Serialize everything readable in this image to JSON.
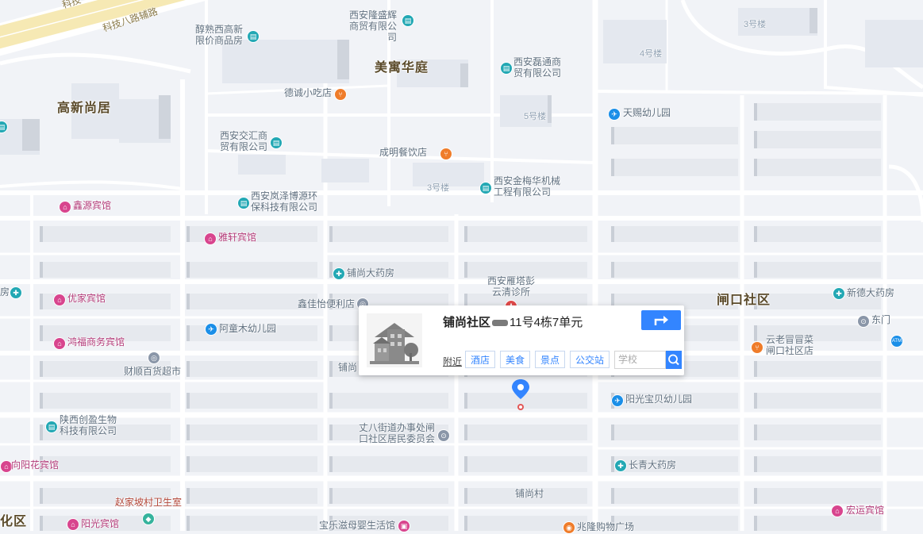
{
  "map": {
    "district_labels": [
      "美寓华庭",
      "高新尚居",
      "闸口社区",
      "化区"
    ],
    "road_labels": [
      "科技八路辅路",
      "科技"
    ],
    "building_labels": [
      "3号楼",
      "4号楼",
      "5号楼",
      "3号楼"
    ],
    "pois": [
      {
        "name": "西安隆盛辉商贸有限公司",
        "cat": "company"
      },
      {
        "name": "醇熟西高新限价商品房",
        "cat": "company"
      },
      {
        "name": "西安磊通商贸有限公司",
        "cat": "company"
      },
      {
        "name": "德诚小吃店",
        "cat": "food"
      },
      {
        "name": "天赐幼儿园",
        "cat": "school"
      },
      {
        "name": "西安交汇商贸有限公司",
        "cat": "company"
      },
      {
        "name": "成明餐饮店",
        "cat": "food"
      },
      {
        "name": "西安金梅华机械工程有限公司",
        "cat": "company"
      },
      {
        "name": "西安岚泽博源环保科技有限公司",
        "cat": "company"
      },
      {
        "name": "鑫源宾馆",
        "cat": "hotel"
      },
      {
        "name": "雅轩宾馆",
        "cat": "hotel"
      },
      {
        "name": "铺尚大药房",
        "cat": "pharmacy"
      },
      {
        "name": "西安雁塔彭云清诊所",
        "cat": "clinic"
      },
      {
        "name": "优家宾馆",
        "cat": "hotel"
      },
      {
        "name": "鑫佳怡便利店",
        "cat": "store"
      },
      {
        "name": "阿童木幼儿园",
        "cat": "school"
      },
      {
        "name": "鸿福商务宾馆",
        "cat": "hotel"
      },
      {
        "name": "财顺百货超市",
        "cat": "store"
      },
      {
        "name": "铺尚",
        "cat": "place"
      },
      {
        "name": "新德大药房",
        "cat": "pharmacy"
      },
      {
        "name": "东门",
        "cat": "gate"
      },
      {
        "name": "云老冒冒菜闸口社区店",
        "cat": "food"
      },
      {
        "name": "阳光宝贝幼儿园",
        "cat": "school"
      },
      {
        "name": "陕西创盈生物科技有限公司",
        "cat": "company"
      },
      {
        "name": "丈八街道办事处闸口社区居民委员会",
        "cat": "gov"
      },
      {
        "name": "向阳花宾馆",
        "cat": "hotel"
      },
      {
        "name": "长青大药房",
        "cat": "pharmacy"
      },
      {
        "name": "赵家坡村卫生室",
        "cat": "clinic"
      },
      {
        "name": "铺尚村",
        "cat": "place"
      },
      {
        "name": "阳光宾馆",
        "cat": "hotel"
      },
      {
        "name": "宝乐滋母婴生活馆",
        "cat": "store"
      },
      {
        "name": "兆隆购物广场",
        "cat": "store"
      },
      {
        "name": "宏运宾馆",
        "cat": "hotel"
      },
      {
        "name": "房",
        "cat": "pharmacy"
      }
    ]
  },
  "popup": {
    "title_bold": "铺尚社区",
    "title_rest": "11号4栋7单元",
    "nearby_label": "附近",
    "categories": [
      "酒店",
      "美食",
      "景点",
      "公交站"
    ],
    "search_placeholder": "学校"
  }
}
